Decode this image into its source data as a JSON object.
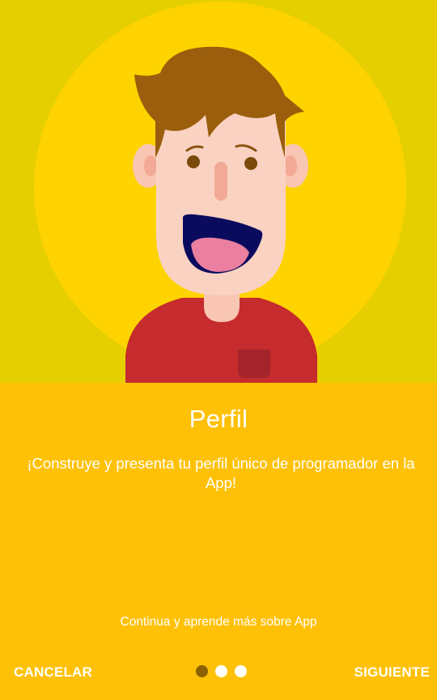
{
  "onboarding": {
    "title": "Perfil",
    "description": "¡Construye y presenta tu perfil único de programador en la App!",
    "hint": "Continua y aprende más sobre App",
    "total_pages": 3,
    "current_page": 1
  },
  "navigation": {
    "cancel_label": "CANCELAR",
    "next_label": "SIGUIENTE"
  },
  "colors": {
    "background": "#FFC107",
    "illustration_background": "#E6CF00",
    "illustration_circle": "#FFD300",
    "active_dot": "#8A6100",
    "inactive_dot": "#FFFFFF",
    "text": "#FFFFFF"
  },
  "icons": {
    "illustration": "smiling-boy-avatar"
  }
}
